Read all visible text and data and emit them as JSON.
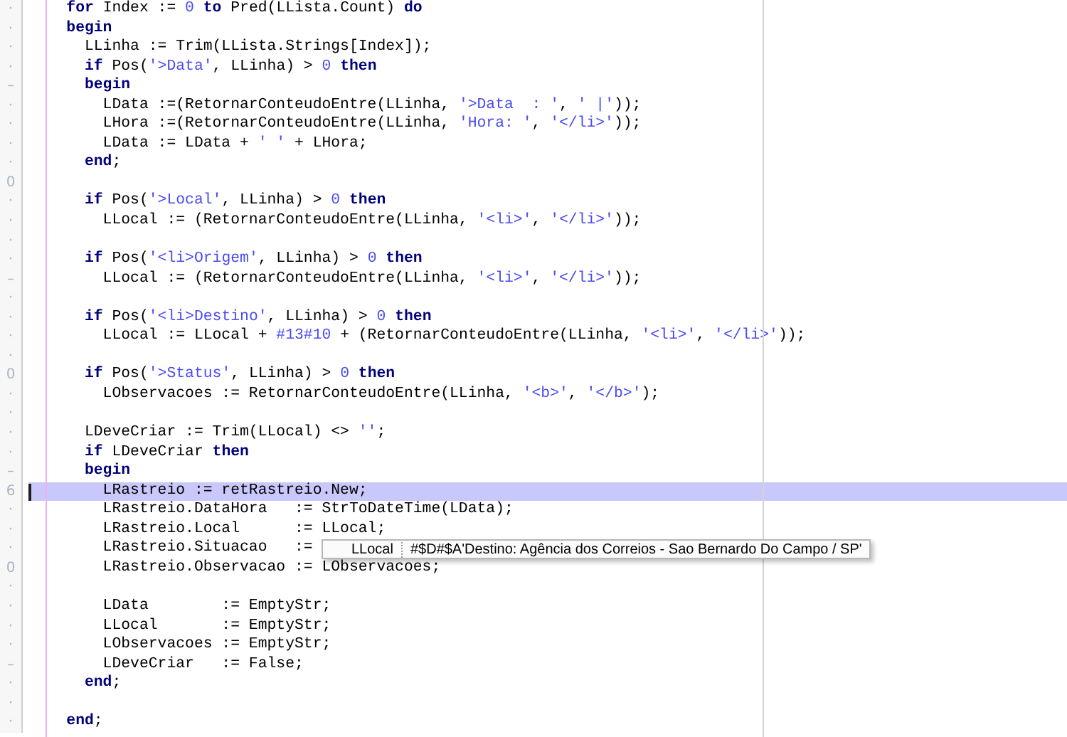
{
  "editor": {
    "lines": [
      {
        "gutter": "·",
        "selected": false,
        "tokens": [
          {
            "kind": "kw",
            "text": "    for"
          },
          {
            "kind": "txt",
            "text": " Index := "
          },
          {
            "kind": "num",
            "text": "0"
          },
          {
            "kind": "kw",
            "text": " to"
          },
          {
            "kind": "txt",
            "text": " Pred(LLista.Count) "
          },
          {
            "kind": "kw",
            "text": "do"
          }
        ]
      },
      {
        "gutter": "·",
        "selected": false,
        "tokens": [
          {
            "kind": "kw",
            "text": "    begin"
          }
        ]
      },
      {
        "gutter": "·",
        "selected": false,
        "tokens": [
          {
            "kind": "txt",
            "text": "      LLinha := Trim(LLista.Strings[Index]);"
          }
        ]
      },
      {
        "gutter": "·",
        "selected": false,
        "tokens": [
          {
            "kind": "kw",
            "text": "      if"
          },
          {
            "kind": "txt",
            "text": " Pos("
          },
          {
            "kind": "str",
            "text": "'>Data'"
          },
          {
            "kind": "txt",
            "text": ", LLinha) > "
          },
          {
            "kind": "num",
            "text": "0"
          },
          {
            "kind": "kw",
            "text": " then"
          }
        ]
      },
      {
        "gutter": "–",
        "selected": false,
        "tokens": [
          {
            "kind": "kw",
            "text": "      begin"
          }
        ]
      },
      {
        "gutter": "·",
        "selected": false,
        "tokens": [
          {
            "kind": "txt",
            "text": "        LData :=(RetornarConteudoEntre(LLinha, "
          },
          {
            "kind": "str",
            "text": "'>Data  : '"
          },
          {
            "kind": "txt",
            "text": ", "
          },
          {
            "kind": "str",
            "text": "' |'"
          },
          {
            "kind": "txt",
            "text": "));"
          }
        ]
      },
      {
        "gutter": "·",
        "selected": false,
        "tokens": [
          {
            "kind": "txt",
            "text": "        LHora :=(RetornarConteudoEntre(LLinha, "
          },
          {
            "kind": "str",
            "text": "'Hora: '"
          },
          {
            "kind": "txt",
            "text": ", "
          },
          {
            "kind": "str",
            "text": "'</li>'"
          },
          {
            "kind": "txt",
            "text": "));"
          }
        ]
      },
      {
        "gutter": "·",
        "selected": false,
        "tokens": [
          {
            "kind": "txt",
            "text": "        LData := LData + "
          },
          {
            "kind": "str",
            "text": "' '"
          },
          {
            "kind": "txt",
            "text": " + LHora;"
          }
        ]
      },
      {
        "gutter": "·",
        "selected": false,
        "tokens": [
          {
            "kind": "kw",
            "text": "      end"
          },
          {
            "kind": "txt",
            "text": ";"
          }
        ]
      },
      {
        "gutter": "0",
        "selected": false
      },
      {
        "gutter": "·",
        "selected": false,
        "tokens": [
          {
            "kind": "kw",
            "text": "      if"
          },
          {
            "kind": "txt",
            "text": " Pos("
          },
          {
            "kind": "str",
            "text": "'>Local'"
          },
          {
            "kind": "txt",
            "text": ", LLinha) > "
          },
          {
            "kind": "num",
            "text": "0"
          },
          {
            "kind": "kw",
            "text": " then"
          }
        ]
      },
      {
        "gutter": "·",
        "selected": false,
        "tokens": [
          {
            "kind": "txt",
            "text": "        LLocal := (RetornarConteudoEntre(LLinha, "
          },
          {
            "kind": "str",
            "text": "'<li>'"
          },
          {
            "kind": "txt",
            "text": ", "
          },
          {
            "kind": "str",
            "text": "'</li>'"
          },
          {
            "kind": "txt",
            "text": "));"
          }
        ]
      },
      {
        "gutter": "·",
        "selected": false
      },
      {
        "gutter": "·",
        "selected": false,
        "tokens": [
          {
            "kind": "kw",
            "text": "      if"
          },
          {
            "kind": "txt",
            "text": " Pos("
          },
          {
            "kind": "str",
            "text": "'<li>Origem'"
          },
          {
            "kind": "txt",
            "text": ", LLinha) > "
          },
          {
            "kind": "num",
            "text": "0"
          },
          {
            "kind": "kw",
            "text": " then"
          }
        ]
      },
      {
        "gutter": "–",
        "selected": false,
        "tokens": [
          {
            "kind": "txt",
            "text": "        LLocal := (RetornarConteudoEntre(LLinha, "
          },
          {
            "kind": "str",
            "text": "'<li>'"
          },
          {
            "kind": "txt",
            "text": ", "
          },
          {
            "kind": "str",
            "text": "'</li>'"
          },
          {
            "kind": "txt",
            "text": "));"
          }
        ]
      },
      {
        "gutter": "·",
        "selected": false
      },
      {
        "gutter": "·",
        "selected": false,
        "tokens": [
          {
            "kind": "kw",
            "text": "      if"
          },
          {
            "kind": "txt",
            "text": " Pos("
          },
          {
            "kind": "str",
            "text": "'<li>Destino'"
          },
          {
            "kind": "txt",
            "text": ", LLinha) > "
          },
          {
            "kind": "num",
            "text": "0"
          },
          {
            "kind": "kw",
            "text": " then"
          }
        ]
      },
      {
        "gutter": "·",
        "selected": false,
        "tokens": [
          {
            "kind": "txt",
            "text": "        LLocal := LLocal + "
          },
          {
            "kind": "num",
            "text": "#13#10"
          },
          {
            "kind": "txt",
            "text": " + (RetornarConteudoEntre(LLinha, "
          },
          {
            "kind": "str",
            "text": "'<li>'"
          },
          {
            "kind": "txt",
            "text": ", "
          },
          {
            "kind": "str",
            "text": "'</li>'"
          },
          {
            "kind": "txt",
            "text": "));"
          }
        ]
      },
      {
        "gutter": "·",
        "selected": false
      },
      {
        "gutter": "0",
        "selected": false,
        "tokens": [
          {
            "kind": "kw",
            "text": "      if"
          },
          {
            "kind": "txt",
            "text": " Pos("
          },
          {
            "kind": "str",
            "text": "'>Status'"
          },
          {
            "kind": "txt",
            "text": ", LLinha) > "
          },
          {
            "kind": "num",
            "text": "0"
          },
          {
            "kind": "kw",
            "text": " then"
          }
        ]
      },
      {
        "gutter": "·",
        "selected": false,
        "tokens": [
          {
            "kind": "txt",
            "text": "        LObservacoes := RetornarConteudoEntre(LLinha, "
          },
          {
            "kind": "str",
            "text": "'<b>'"
          },
          {
            "kind": "txt",
            "text": ", "
          },
          {
            "kind": "str",
            "text": "'</b>'"
          },
          {
            "kind": "txt",
            "text": ");"
          }
        ]
      },
      {
        "gutter": "·",
        "selected": false
      },
      {
        "gutter": "·",
        "selected": false,
        "tokens": [
          {
            "kind": "txt",
            "text": "      LDeveCriar := Trim(LLocal) <> "
          },
          {
            "kind": "str",
            "text": "''"
          },
          {
            "kind": "txt",
            "text": ";"
          }
        ]
      },
      {
        "gutter": "·",
        "selected": false,
        "tokens": [
          {
            "kind": "kw",
            "text": "      if"
          },
          {
            "kind": "txt",
            "text": " LDeveCriar "
          },
          {
            "kind": "kw",
            "text": "then"
          }
        ]
      },
      {
        "gutter": "–",
        "selected": false,
        "tokens": [
          {
            "kind": "kw",
            "text": "      begin"
          }
        ]
      },
      {
        "gutter": "6",
        "selected": true,
        "tokens": [
          {
            "kind": "txt",
            "text": "        LRastreio := retRastreio.New;"
          }
        ]
      },
      {
        "gutter": "·",
        "selected": false,
        "tokens": [
          {
            "kind": "txt",
            "text": "        LRastreio.DataHora   := StrToDateTime(LData);"
          }
        ]
      },
      {
        "gutter": "·",
        "selected": false,
        "tokens": [
          {
            "kind": "txt",
            "text": "        LRastreio.Local      := LLocal;"
          }
        ]
      },
      {
        "gutter": "·",
        "selected": false,
        "tokens": [
          {
            "kind": "txt",
            "text": "        LRastreio.Situacao   :="
          }
        ]
      },
      {
        "gutter": "0",
        "selected": false,
        "tokens": [
          {
            "kind": "txt",
            "text": "        LRastreio.Observacao := LObservacoes;"
          }
        ]
      },
      {
        "gutter": "·",
        "selected": false
      },
      {
        "gutter": "·",
        "selected": false,
        "tokens": [
          {
            "kind": "txt",
            "text": "        LData        := EmptyStr;"
          }
        ]
      },
      {
        "gutter": "·",
        "selected": false,
        "tokens": [
          {
            "kind": "txt",
            "text": "        LLocal       := EmptyStr;"
          }
        ]
      },
      {
        "gutter": "·",
        "selected": false,
        "tokens": [
          {
            "kind": "txt",
            "text": "        LObservacoes := EmptyStr;"
          }
        ]
      },
      {
        "gutter": "–",
        "selected": false,
        "tokens": [
          {
            "kind": "txt",
            "text": "        LDeveCriar   := False;"
          }
        ]
      },
      {
        "gutter": "·",
        "selected": false,
        "tokens": [
          {
            "kind": "kw",
            "text": "      end"
          },
          {
            "kind": "txt",
            "text": ";"
          }
        ]
      },
      {
        "gutter": "·",
        "selected": false
      },
      {
        "gutter": "·",
        "selected": false,
        "tokens": [
          {
            "kind": "kw",
            "text": "    end"
          },
          {
            "kind": "txt",
            "text": ";"
          }
        ]
      }
    ]
  },
  "tooltip": {
    "name": "LLocal",
    "value": "#$D#$A'Destino: Agência dos Correios - Sao Bernardo Do Campo / SP'"
  }
}
